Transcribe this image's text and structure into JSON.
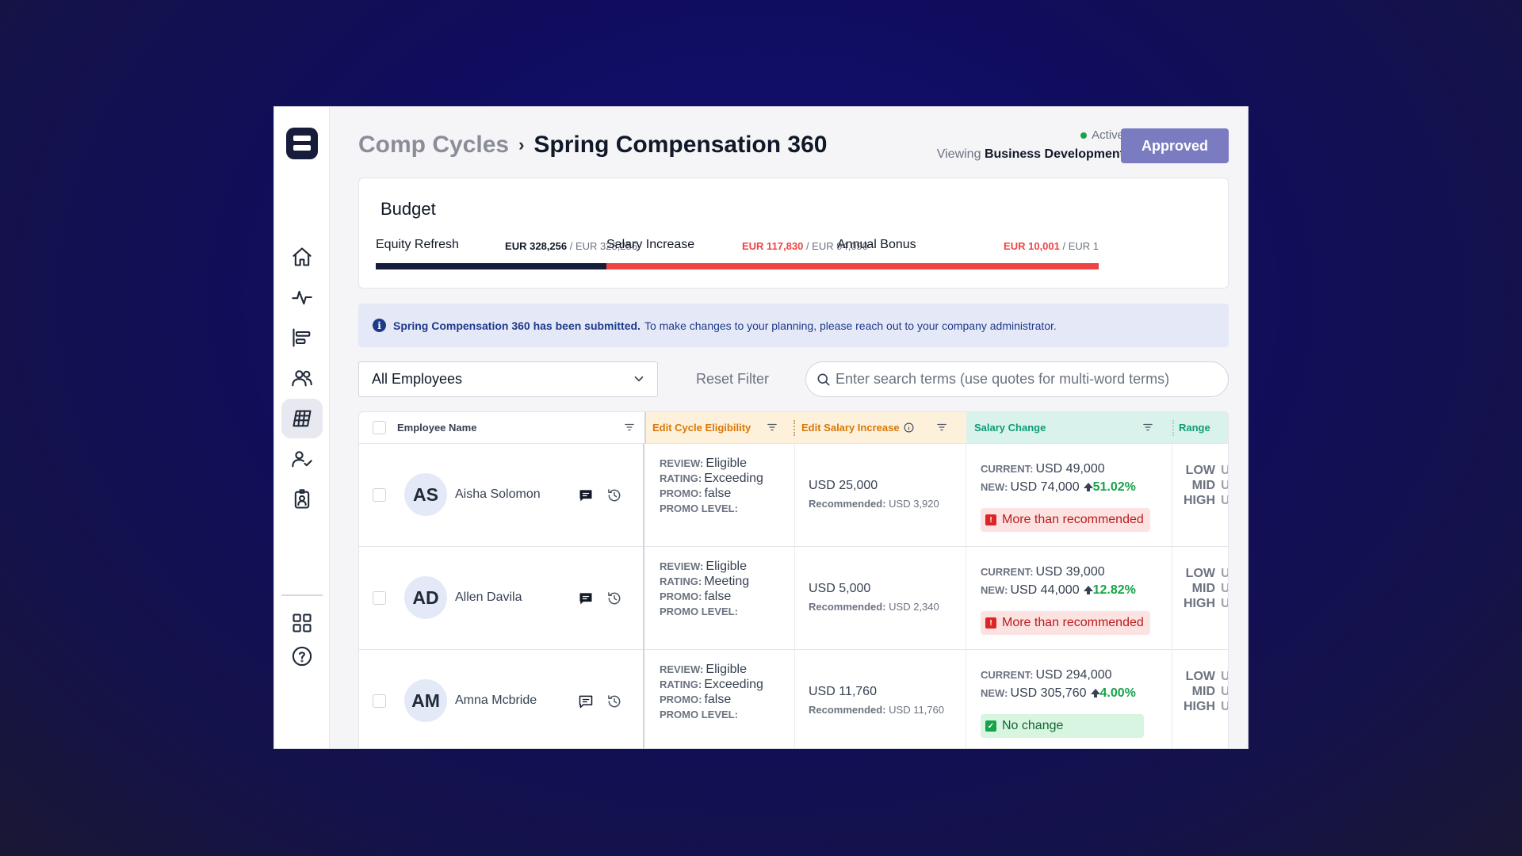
{
  "breadcrumb": {
    "parent": "Comp Cycles",
    "separator": "›",
    "current": "Spring Compensation 360"
  },
  "status": {
    "label": "Active",
    "color": "#16a34a"
  },
  "viewing": {
    "prefix": "Viewing",
    "team": "Business Development"
  },
  "approved_button": {
    "label": "Approved",
    "color": "#7b7bc2"
  },
  "budget": {
    "title": "Budget",
    "items": [
      {
        "label": "Equity Refresh",
        "used": "EUR 328,256",
        "total": " / EUR 328,256",
        "used_color": "#111827",
        "bar_color": "#171c3a"
      },
      {
        "label": "Salary Increase",
        "used": "EUR 117,830",
        "total": " / EUR 94,090",
        "used_color": "#ef4444",
        "bar_color": "#ef4444"
      },
      {
        "label": "Annual Bonus",
        "used": "EUR 10,001",
        "total": " / EUR 1",
        "used_color": "#ef4444",
        "bar_color": "#ef4444"
      }
    ]
  },
  "banner": {
    "bold": "Spring Compensation 360 has been submitted.",
    "text": "To make changes to your planning, please reach out to your company administrator."
  },
  "filters": {
    "select_value": "All Employees",
    "reset_label": "Reset Filter",
    "search_placeholder": "Enter search terms (use quotes for multi-word terms)"
  },
  "table": {
    "headers": {
      "name": "Employee Name",
      "eligibility": "Edit Cycle Eligibility",
      "salary": "Edit Salary Increase",
      "change": "Salary Change",
      "range": "Range"
    },
    "keys": {
      "review": "REVIEW:",
      "rating": "RATING:",
      "promo": "PROMO:",
      "promo_level": "PROMO LEVEL:",
      "recommended": "Recommended:",
      "current": "CURRENT:",
      "new": "NEW:",
      "low": "LOW",
      "mid": "MID",
      "high": "HIGH",
      "range_cut": "U"
    },
    "rows": [
      {
        "initials": "AS",
        "name": "Aisha Solomon",
        "review": "Eligible",
        "rating": "Exceeding",
        "promo": "false",
        "salary": "USD 25,000",
        "recommended": "USD 3,920",
        "current": "USD 49,000",
        "new": "USD 74,000",
        "pct": "51.02%",
        "badge": "More than recommended",
        "badge_type": "warn"
      },
      {
        "initials": "AD",
        "name": "Allen Davila",
        "review": "Eligible",
        "rating": "Meeting",
        "promo": "false",
        "salary": "USD 5,000",
        "recommended": "USD 2,340",
        "current": "USD 39,000",
        "new": "USD 44,000",
        "pct": "12.82%",
        "badge": "More than recommended",
        "badge_type": "warn"
      },
      {
        "initials": "AM",
        "name": "Amna Mcbride",
        "review": "Eligible",
        "rating": "Exceeding",
        "promo": "false",
        "salary": "USD 11,760",
        "recommended": "USD 11,760",
        "current": "USD 294,000",
        "new": "USD 305,760",
        "pct": "4.00%",
        "badge": "No change",
        "badge_type": "ok"
      }
    ]
  }
}
